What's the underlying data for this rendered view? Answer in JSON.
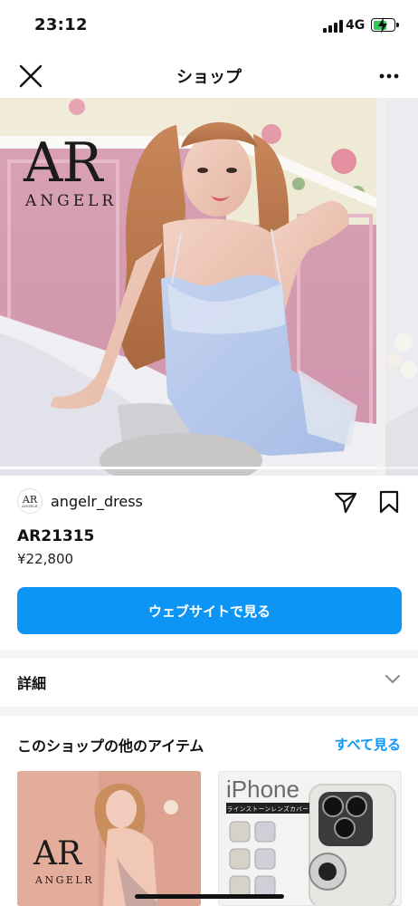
{
  "status_bar": {
    "time": "23:12",
    "network": "4G",
    "battery_level": 0.64,
    "battery_color": "#34c759"
  },
  "nav": {
    "title": "ショップ",
    "close_icon": "close-icon",
    "more_icon": "more-horizontal-icon"
  },
  "hero": {
    "brand_logo": "AR",
    "brand_name": "ANGELR",
    "carousel_position": 0.9
  },
  "seller": {
    "avatar_logo": "AR",
    "avatar_name": "ANGELR",
    "username": "angelr_dress",
    "share_icon": "share-icon",
    "bookmark_icon": "bookmark-icon"
  },
  "product": {
    "code": "AR21315",
    "price": "¥22,800",
    "cta_label": "ウェブサイトで見る",
    "cta_color": "#0d95f6"
  },
  "details": {
    "label": "詳細",
    "chevron_icon": "chevron-down-icon"
  },
  "more_items": {
    "title": "このショップの他のアイテム",
    "see_all": "すべて見る",
    "items": [
      {
        "logo": "AR",
        "brand_name": "ANGELR"
      },
      {
        "brand": "iPhone",
        "banner": "ラインストーンレンズカバー"
      }
    ]
  }
}
